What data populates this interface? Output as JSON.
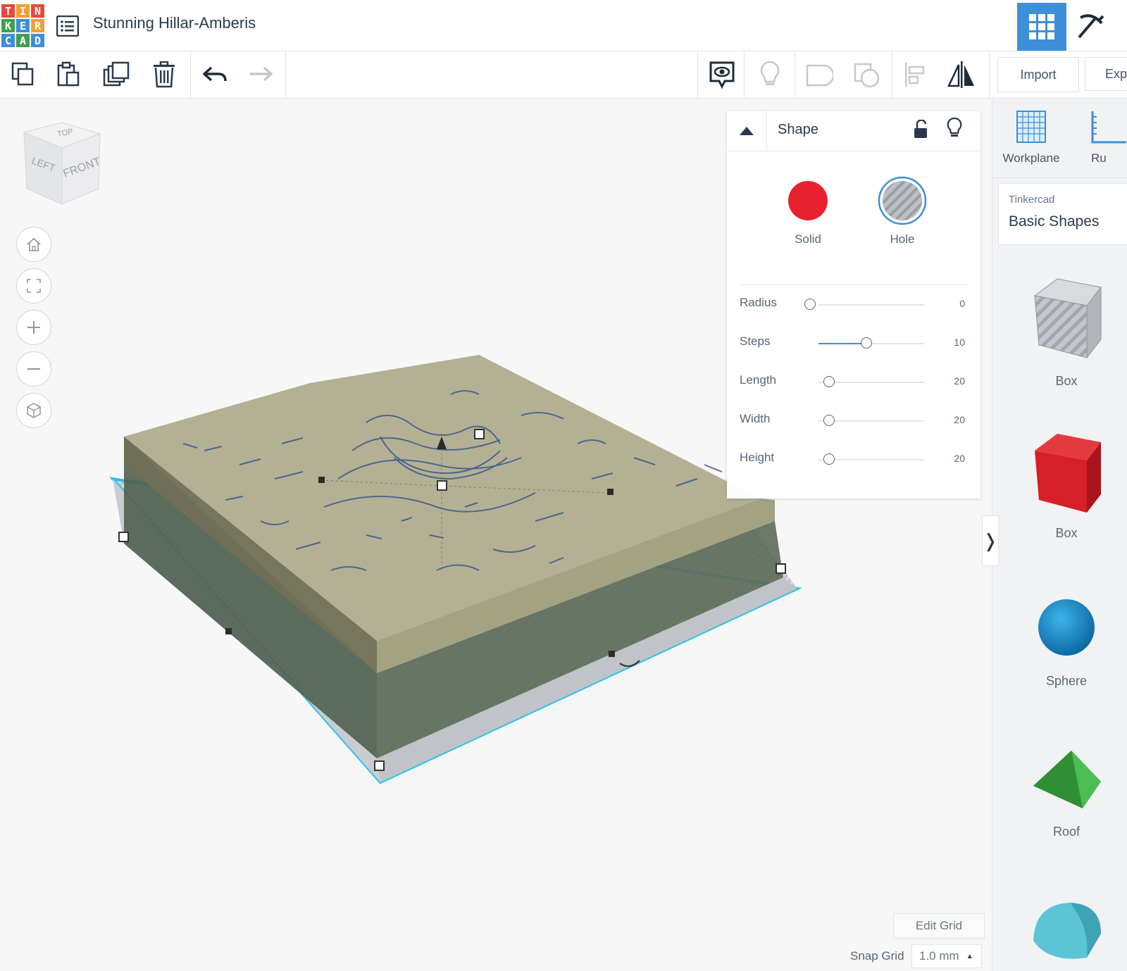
{
  "app": {
    "logo_letters": [
      "T",
      "I",
      "N",
      "K",
      "E",
      "R",
      "C",
      "A",
      "D"
    ],
    "logo_colors": [
      "#e64a3c",
      "#f0a030",
      "#e64a3c",
      "#40a050",
      "#3d8fd9",
      "#f0a030",
      "#3d8fd9",
      "#40a050",
      "#3d8fd9"
    ],
    "project_title": "Stunning Hillar-Amberis"
  },
  "toolbar": {
    "copy_icon": "copy-icon",
    "paste_icon": "paste-icon",
    "duplicate_icon": "duplicate-icon",
    "delete_icon": "trash-icon",
    "undo_icon": "undo-icon",
    "redo_icon": "redo-icon",
    "import_label": "Import",
    "export_label": "Exp"
  },
  "viewcube": {
    "top": "TOP",
    "left": "LEFT",
    "front": "FRONT"
  },
  "shape_panel": {
    "title": "Shape",
    "solid_label": "Solid",
    "hole_label": "Hole",
    "solid_color": "#e8212e",
    "properties": [
      {
        "name": "Radius",
        "value": "0",
        "fraction": 0.0
      },
      {
        "name": "Steps",
        "value": "10",
        "fraction": 0.45
      },
      {
        "name": "Length",
        "value": "20",
        "fraction": 0.1
      },
      {
        "name": "Width",
        "value": "20",
        "fraction": 0.1
      },
      {
        "name": "Height",
        "value": "20",
        "fraction": 0.1
      }
    ]
  },
  "right_panel": {
    "workplane_label": "Workplane",
    "ruler_label": "Ru",
    "library_source": "Tinkercad",
    "library_name": "Basic Shapes",
    "shapes": [
      {
        "label": "Box",
        "kind": "hole-box"
      },
      {
        "label": "Box",
        "kind": "red-box",
        "color": "#d42026"
      },
      {
        "label": "Sphere",
        "kind": "sphere",
        "color": "#1a8fd0"
      },
      {
        "label": "Roof",
        "kind": "roof",
        "color": "#3aa640"
      },
      {
        "label": "",
        "kind": "cylinder-half",
        "color": "#5bc4d6"
      }
    ]
  },
  "bottom": {
    "edit_grid_label": "Edit Grid",
    "snap_grid_label": "Snap Grid",
    "snap_grid_value": "1.0 mm"
  },
  "colors": {
    "accent": "#3d8fd9",
    "selection": "#2bc4ea",
    "terrain_top": "#b4b094",
    "terrain_side": "#9c9a80",
    "contours": "#3a5a8a"
  }
}
